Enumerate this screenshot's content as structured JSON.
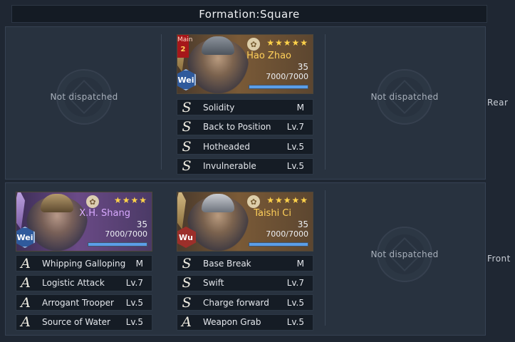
{
  "title": "Formation:Square",
  "rows": {
    "rear_label": "Rear",
    "front_label": "Front"
  },
  "empty_text": "Not dispatched",
  "heroes": {
    "hao_zhao": {
      "main_tag": "Main",
      "main_num": "2",
      "faction": "Wei",
      "stars": "★★★★★",
      "name": "Hao Zhao",
      "level": "35",
      "troops": "7000/7000",
      "troops_fraction": 1.0,
      "skills": [
        {
          "grade": "S",
          "name": "Solidity",
          "level": "M"
        },
        {
          "grade": "S",
          "name": "Back to Position",
          "level": "Lv.7"
        },
        {
          "grade": "S",
          "name": "Hotheaded",
          "level": "Lv.5"
        },
        {
          "grade": "S",
          "name": "Invulnerable",
          "level": "Lv.5"
        }
      ]
    },
    "xh_shang": {
      "faction": "Wei",
      "stars": "★★★★",
      "name": "X.H. Shang",
      "level": "35",
      "troops": "7000/7000",
      "troops_fraction": 1.0,
      "skills": [
        {
          "grade": "A",
          "name": "Whipping Galloping",
          "level": "M"
        },
        {
          "grade": "A",
          "name": "Logistic Attack",
          "level": "Lv.7"
        },
        {
          "grade": "A",
          "name": "Arrogant Trooper",
          "level": "Lv.5"
        },
        {
          "grade": "A",
          "name": "Source of Water",
          "level": "Lv.5"
        }
      ]
    },
    "taishi_ci": {
      "faction": "Wu",
      "stars": "★★★★★",
      "name": "Taishi Ci",
      "level": "35",
      "troops": "7000/7000",
      "troops_fraction": 1.0,
      "skills": [
        {
          "grade": "S",
          "name": "Base Break",
          "level": "M"
        },
        {
          "grade": "S",
          "name": "Swift",
          "level": "Lv.7"
        },
        {
          "grade": "S",
          "name": "Charge forward",
          "level": "Lv.5"
        },
        {
          "grade": "A",
          "name": "Weapon Grab",
          "level": "Lv.5"
        }
      ]
    }
  },
  "colors": {
    "background": "#1f2733",
    "panel": "#28323f",
    "gold_name": "#ffd05a",
    "purple_name": "#d8a9ff",
    "star": "#ffd24a",
    "troop_bar": "#5b9ee8"
  }
}
